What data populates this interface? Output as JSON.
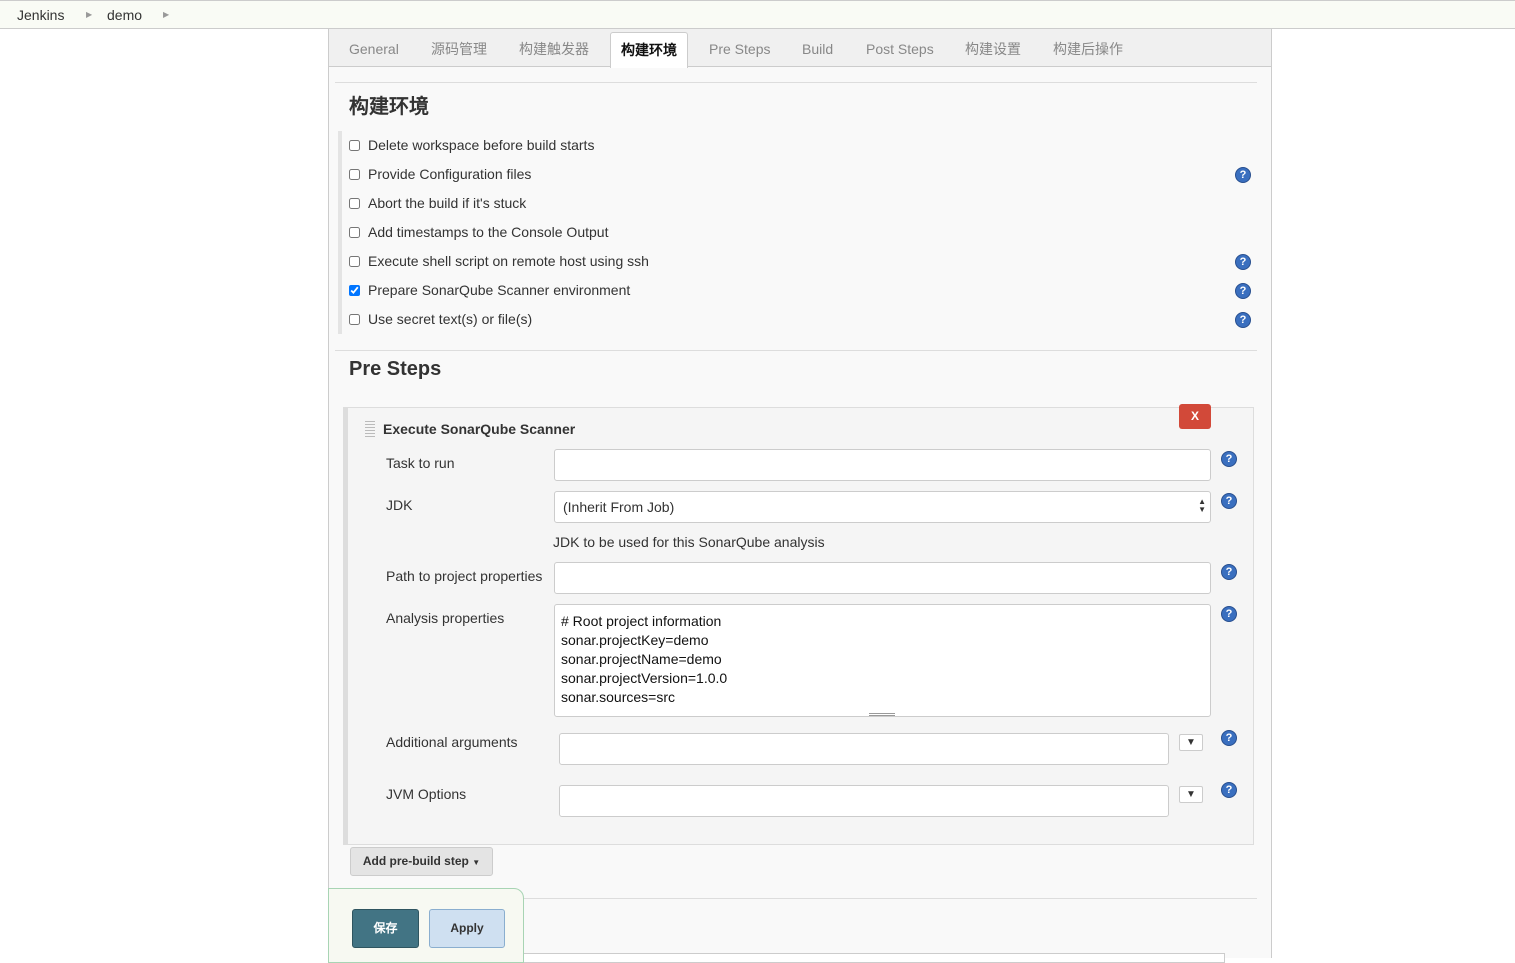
{
  "breadcrumb": [
    "Jenkins",
    "demo"
  ],
  "tabs": [
    "General",
    "源码管理",
    "构建触发器",
    "构建环境",
    "Pre Steps",
    "Build",
    "Post Steps",
    "构建设置",
    "构建后操作"
  ],
  "active_tab": "构建环境",
  "build_env": {
    "title": "构建环境",
    "options": [
      {
        "label": "Delete workspace before build starts",
        "checked": false,
        "help": false
      },
      {
        "label": "Provide Configuration files",
        "checked": false,
        "help": true
      },
      {
        "label": "Abort the build if it's stuck",
        "checked": false,
        "help": false
      },
      {
        "label": "Add timestamps to the Console Output",
        "checked": false,
        "help": false
      },
      {
        "label": "Execute shell script on remote host using ssh",
        "checked": false,
        "help": true
      },
      {
        "label": "Prepare SonarQube Scanner environment",
        "checked": true,
        "help": true
      },
      {
        "label": "Use secret text(s) or file(s)",
        "checked": false,
        "help": true
      }
    ]
  },
  "pre_steps": {
    "title": "Pre Steps",
    "step": {
      "title": "Execute SonarQube Scanner",
      "delete_label": "X",
      "task_label": "Task to run",
      "task_value": "",
      "jdk_label": "JDK",
      "jdk_value": "(Inherit From Job)",
      "jdk_desc": "JDK to be used for this SonarQube analysis",
      "path_label": "Path to project properties",
      "path_value": "",
      "analysis_label": "Analysis properties",
      "analysis_value": "# Root project information\nsonar.projectKey=demo\nsonar.projectName=demo\nsonar.projectVersion=1.0.0\nsonar.sources=src",
      "args_label": "Additional arguments",
      "jvm_label": "JVM Options"
    },
    "add_button": "Add pre-build step"
  },
  "buttons": {
    "save": "保存",
    "apply": "Apply"
  },
  "colors": {
    "save": "#427484",
    "apply": "#cfe0f1",
    "delete": "#d24939",
    "help": "#3a6fbf"
  }
}
